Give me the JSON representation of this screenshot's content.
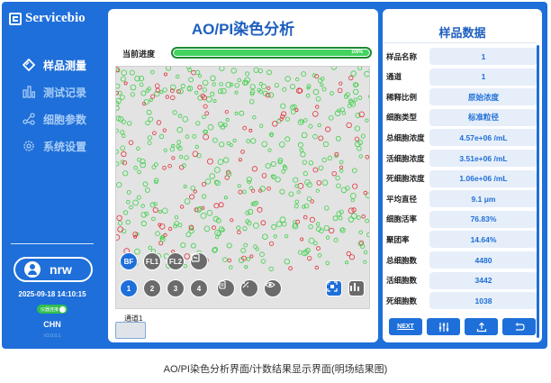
{
  "app": {
    "logo_text": "Servicebio"
  },
  "sidebar": {
    "items": [
      {
        "label": "样品测量",
        "icon": "diamond-icon",
        "active": true
      },
      {
        "label": "测试记录",
        "icon": "bar-chart-icon",
        "active": false
      },
      {
        "label": "细胞参数",
        "icon": "share-nodes-icon",
        "active": false
      },
      {
        "label": "系统设置",
        "icon": "gear-icon",
        "active": false
      }
    ],
    "user": "nrw",
    "datetime": "2025-09-18 14:10:15",
    "status_toggle": "仪器连接",
    "language": "CHN",
    "version": "V2.0.0.1"
  },
  "main": {
    "title": "AO/PI染色分析",
    "progress": {
      "label": "当前进度",
      "value": 100,
      "text": "100%"
    },
    "view_buttons": [
      "BF",
      "FL1",
      "FL2"
    ],
    "field_buttons": [
      "1",
      "2",
      "3",
      "4"
    ],
    "channel": {
      "label": "通道1"
    }
  },
  "results": {
    "title": "样品数据",
    "rows": [
      {
        "label": "样品名称",
        "value": "1"
      },
      {
        "label": "通道",
        "value": "1"
      },
      {
        "label": "稀释比例",
        "value": "原始浓度"
      },
      {
        "label": "细胞类型",
        "value": "标准粒径"
      },
      {
        "label": "总细胞浓度",
        "value": "4.57e+06 /mL"
      },
      {
        "label": "活细胞浓度",
        "value": "3.51e+06 /mL"
      },
      {
        "label": "死细胞浓度",
        "value": "1.06e+06 /mL"
      },
      {
        "label": "平均直径",
        "value": "9.1 μm"
      },
      {
        "label": "细胞活率",
        "value": "76.83%"
      },
      {
        "label": "聚团率",
        "value": "14.64%"
      },
      {
        "label": "总细胞数",
        "value": "4480"
      },
      {
        "label": "活细胞数",
        "value": "3442"
      },
      {
        "label": "死细胞数",
        "value": "1038"
      }
    ],
    "actions": {
      "next_label": "NEXT"
    }
  },
  "caption": "AO/PI染色分析界面/计数结果显示界面(明场结果图)",
  "colors": {
    "brand": "#1e6fd9",
    "live": "#3fcf4a",
    "dead": "#e0323a",
    "progress": "#43d35f"
  }
}
